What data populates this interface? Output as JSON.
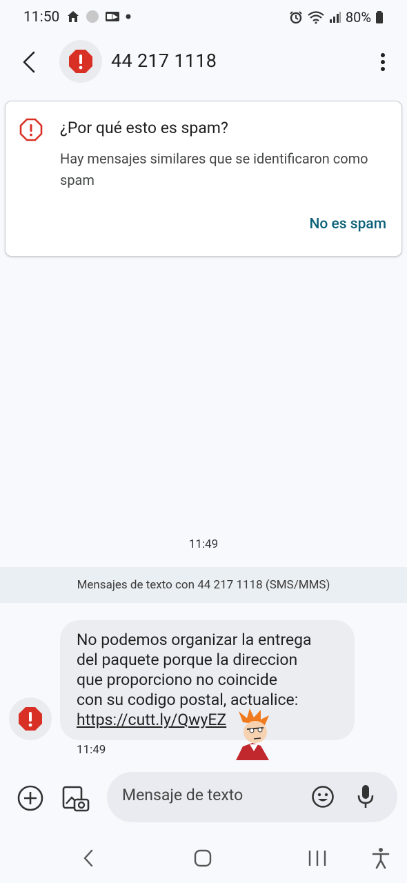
{
  "status_bar": {
    "time": "11:50",
    "battery": "80%"
  },
  "header": {
    "title": "44 217 1118",
    "icons": [
      "back-arrow-icon",
      "spam-alert-icon",
      "more-vert-icon"
    ]
  },
  "spam_card": {
    "title": "¿Por qué esto es spam?",
    "body": "Hay mensajes similares que se identificaron como spam",
    "action": "No es spam"
  },
  "conversation": {
    "time_separator": "11:49",
    "sms_banner": "Mensajes de texto con 44 217 1118 (SMS/MMS)",
    "message": {
      "text_line1": "No podemos organizar la entrega",
      "text_line2": "del paquete porque la direccion",
      "text_line3": "que proporciono no coincide",
      "text_line4": "con su codigo postal, actualice:",
      "link": "https://cutt.ly/QwyEZ",
      "time": "11:49"
    }
  },
  "compose": {
    "placeholder": "Mensaje de texto"
  },
  "colors": {
    "accent": "#0b6178",
    "danger": "#d93025",
    "background": "#f8f9fd",
    "bubble": "#ebedf1"
  }
}
